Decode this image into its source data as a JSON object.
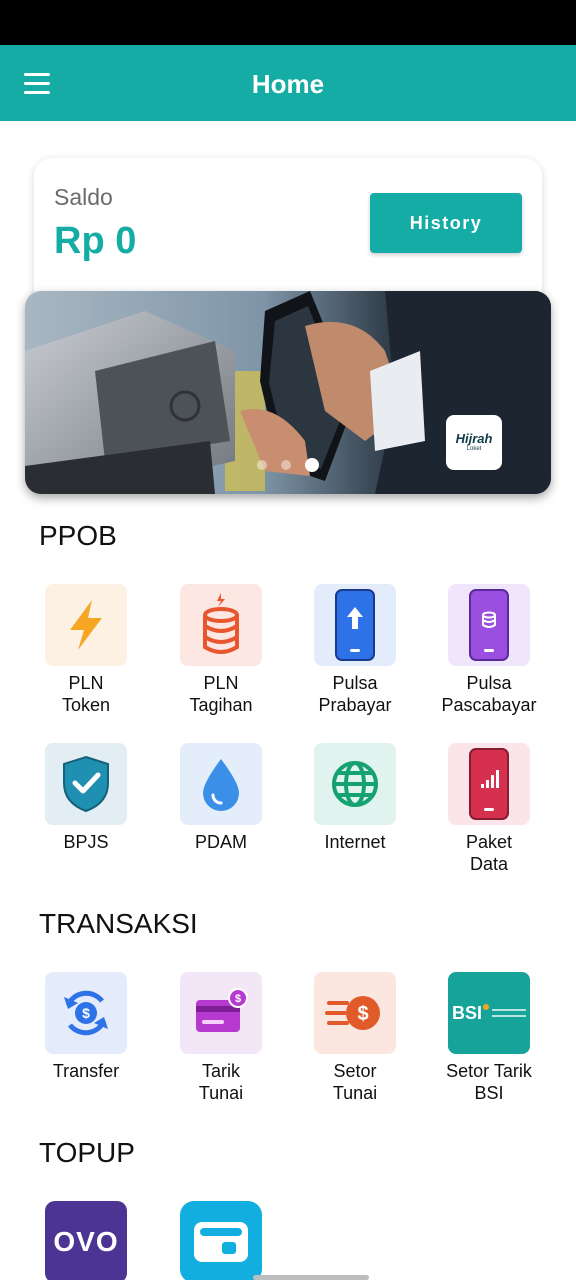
{
  "app_bar": {
    "title": "Home"
  },
  "balance": {
    "label": "Saldo",
    "value": "Rp 0",
    "history_label": "History"
  },
  "banner": {
    "brand": "Hijrah",
    "brand_sub": "Loket",
    "slide_count": 3,
    "active_slide": 3
  },
  "sections": {
    "ppob": {
      "title": "PPOB",
      "items": [
        {
          "label": "PLN\nToken",
          "icon": "lightning-icon"
        },
        {
          "label": "PLN\nTagihan",
          "icon": "database-icon"
        },
        {
          "label": "Pulsa\nPrabayar",
          "icon": "phone-upload-icon"
        },
        {
          "label": "Pulsa\nPascabayar",
          "icon": "phone-database-icon"
        },
        {
          "label": "BPJS",
          "icon": "shield-check-icon"
        },
        {
          "label": "PDAM",
          "icon": "water-drop-icon"
        },
        {
          "label": "Internet",
          "icon": "globe-icon"
        },
        {
          "label": "Paket\nData",
          "icon": "phone-signal-icon"
        }
      ]
    },
    "transaksi": {
      "title": "TRANSAKSI",
      "items": [
        {
          "label": "Transfer",
          "icon": "transfer-icon"
        },
        {
          "label": "Tarik\nTunai",
          "icon": "card-withdraw-icon"
        },
        {
          "label": "Setor\nTunai",
          "icon": "cash-deposit-icon"
        },
        {
          "label": "Setor Tarik\nBSI",
          "icon": "bsi-logo-icon",
          "logo_text": "BSI"
        }
      ]
    },
    "topup": {
      "title": "TOPUP",
      "items": [
        {
          "label": "",
          "icon": "ovo-logo-icon",
          "logo_text": "OVO"
        },
        {
          "label": "",
          "icon": "wallet-icon"
        }
      ]
    }
  },
  "colors": {
    "primary": "#15aca6",
    "ovo": "#4c3494",
    "bsi": "#15a39a"
  }
}
